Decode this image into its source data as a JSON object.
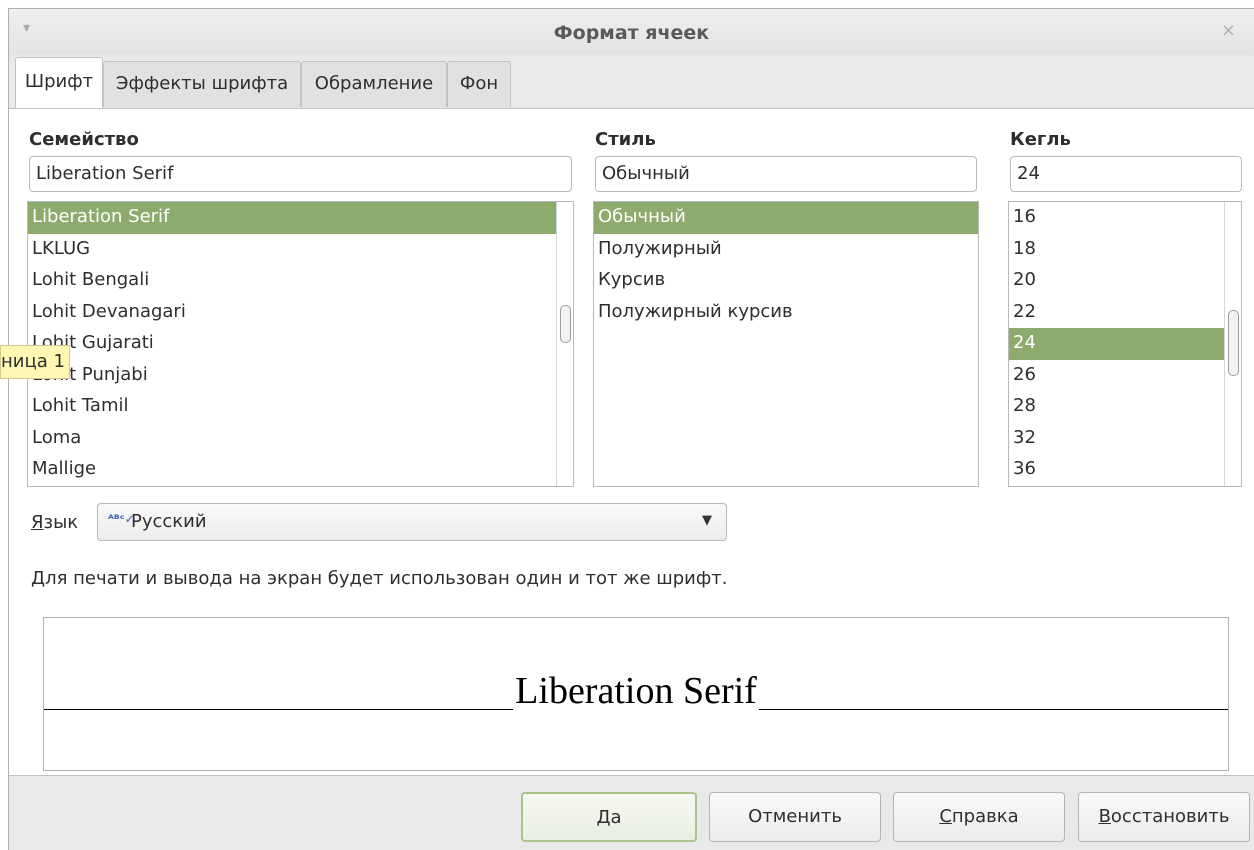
{
  "dialog": {
    "title": "Формат ячеек",
    "menu_glyph": "▾",
    "close_glyph": "×"
  },
  "tabs": [
    {
      "label": "Шрифт",
      "active": true
    },
    {
      "label": "Эффекты шрифта",
      "active": false
    },
    {
      "label": "Обрамление",
      "active": false
    },
    {
      "label": "Фон",
      "active": false
    }
  ],
  "family": {
    "label": "Семейство",
    "value": "Liberation Serif",
    "items": [
      "Liberation Serif",
      "LKLUG",
      "Lohit Bengali",
      "Lohit Devanagari",
      "Lohit Gujarati",
      "Lohit Punjabi",
      "Lohit Tamil",
      "Loma",
      "Mallige"
    ],
    "selected_index": 0
  },
  "style": {
    "label": "Стиль",
    "value": "Обычный",
    "items": [
      "Обычный",
      "Полужирный",
      "Курсив",
      "Полужирный курсив"
    ],
    "selected_index": 0
  },
  "size": {
    "label": "Кегль",
    "value": "24",
    "items": [
      "16",
      "18",
      "20",
      "22",
      "24",
      "26",
      "28",
      "32",
      "36"
    ],
    "selected_index": 4
  },
  "tooltip": {
    "text": "ница 1"
  },
  "language": {
    "label_mnemonic": "Я",
    "label_rest": "зык",
    "icon_glyph": "ᴬᴮᶜ✓",
    "value": "Русский",
    "arrow_glyph": "▼"
  },
  "info_text": "Для печати и вывода на экран будет использован один и тот же шрифт.",
  "preview": {
    "text": "Liberation Serif"
  },
  "buttons": {
    "ok": "Да",
    "cancel": "Отменить",
    "help_mnemonic": "С",
    "help_rest": "правка",
    "reset_mnemonic": "В",
    "reset_rest": "осстановить"
  },
  "colors": {
    "selection": "#8dab6d",
    "tooltip_bg": "#fff8b5",
    "default_button_border": "#a9c48c"
  }
}
